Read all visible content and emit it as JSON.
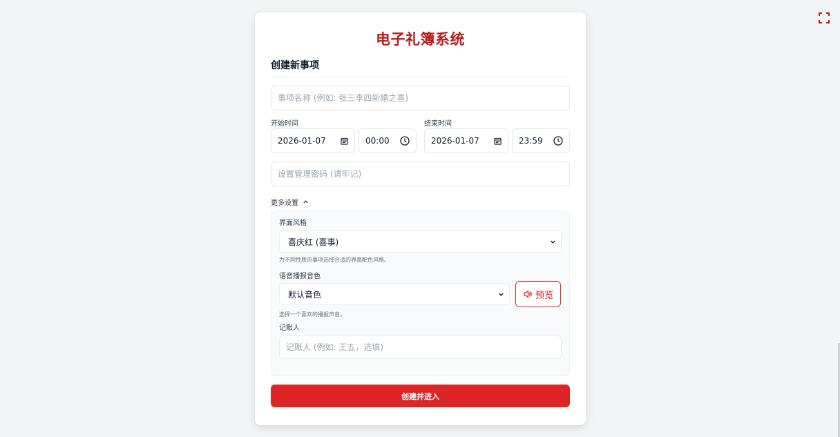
{
  "app": {
    "title": "电子礼簿系统"
  },
  "form": {
    "section_title": "创建新事项",
    "event_name": {
      "value": "",
      "placeholder": "事项名称 (例如: 张三李四新婚之喜)"
    },
    "start": {
      "label": "开始时间",
      "date": "2026-01-07",
      "time": "00:00"
    },
    "end": {
      "label": "结束时间",
      "date": "2026-01-07",
      "time": "23:59"
    },
    "password": {
      "value": "",
      "placeholder": "设置管理密码 (请牢记)"
    },
    "more_settings": {
      "label": "更多设置",
      "expanded": true
    },
    "theme": {
      "label": "界面风格",
      "selected": "喜庆红 (喜事)",
      "hint": "为不同性质的事项选择合适的界面配色风格。"
    },
    "voice": {
      "label": "语音播报音色",
      "selected": "默认音色",
      "hint": "选择一个喜欢的播报声音。",
      "preview_label": "预览"
    },
    "recorder": {
      "label": "记账人",
      "value": "",
      "placeholder": "记账人 (例如: 王五，选填)"
    },
    "submit_label": "创建并进入"
  },
  "colors": {
    "accent": "#dc2626",
    "title": "#b91c1c",
    "background": "#f3f4f6"
  },
  "icons": {
    "fullscreen": "fullscreen-icon",
    "calendar": "calendar-icon",
    "clock": "clock-icon",
    "chevron_up": "chevron-up-icon",
    "chevron_down": "chevron-down-icon",
    "speaker": "speaker-icon"
  }
}
